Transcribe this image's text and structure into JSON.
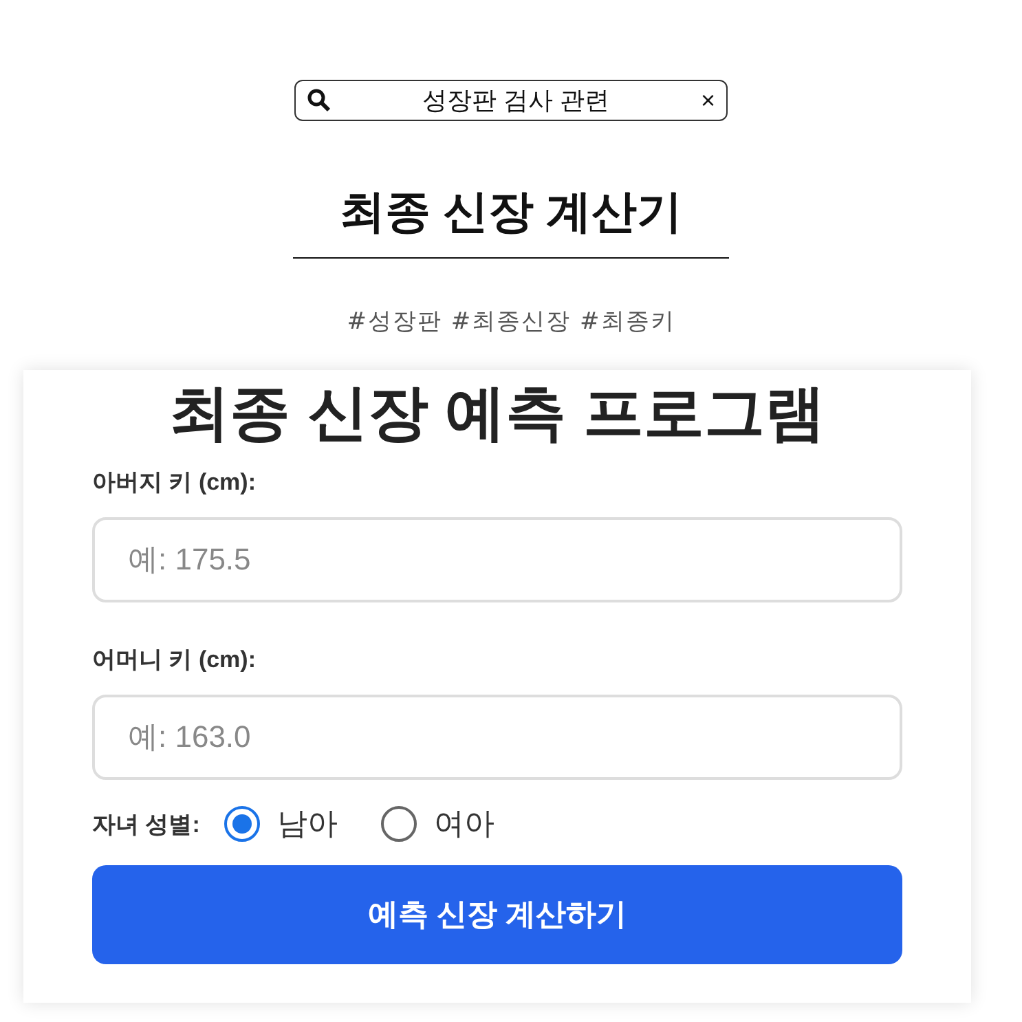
{
  "search": {
    "value": "성장판 검사 관련",
    "clear": "×"
  },
  "title": "최종 신장 계산기",
  "hashtags": "#성장판 #최종신장 #최종키",
  "form": {
    "heading": "최종 신장 예측 프로그램",
    "fields": [
      {
        "label": "아버지 키 (cm):",
        "placeholder": "예: 175.5"
      },
      {
        "label": "어머니 키 (cm):",
        "placeholder": "예: 163.0"
      }
    ],
    "gender": {
      "label": "자녀 성별:",
      "options": [
        {
          "label": "남아",
          "selected": true
        },
        {
          "label": "여아",
          "selected": false
        }
      ]
    },
    "submit": "예측 신장 계산하기"
  }
}
